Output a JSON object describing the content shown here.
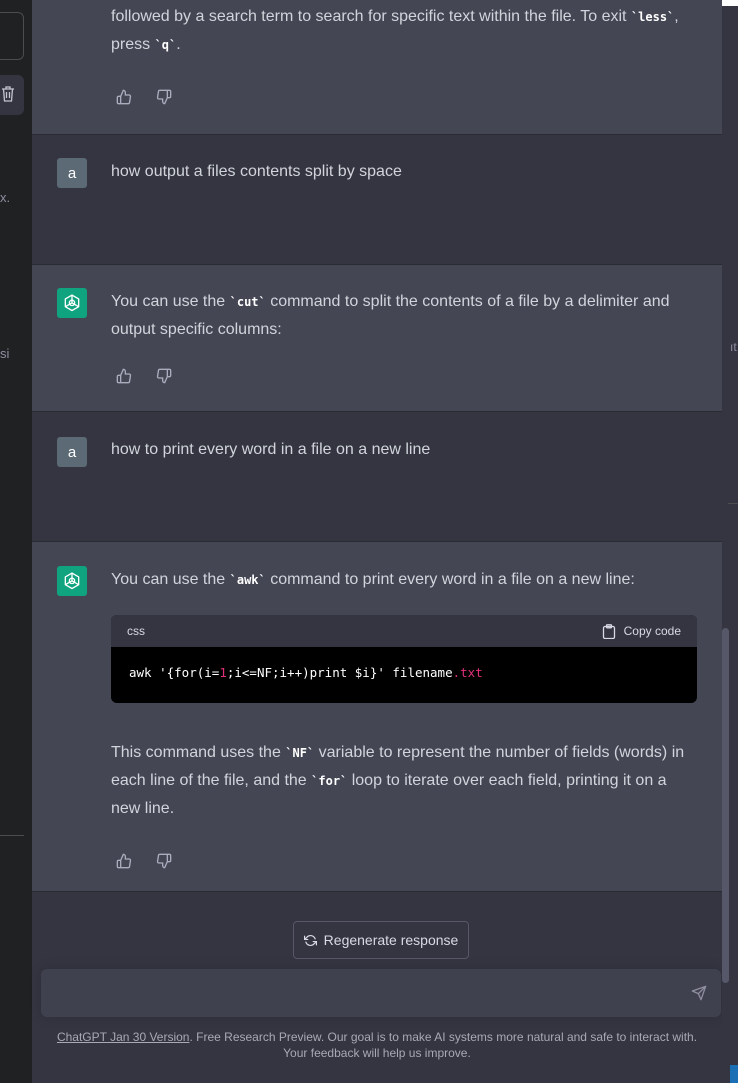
{
  "sidebar": {
    "frag_x": "x.",
    "frag_si": "si"
  },
  "messages": {
    "m0": {
      "role": "assistant",
      "text_a": "followed by a search term to search for specific text within the file. To exit ",
      "code_less": "`less`",
      "text_b": ", press ",
      "code_q": "`q`",
      "text_c": "."
    },
    "m1": {
      "role": "user",
      "avatar": "a",
      "text": "how output a files contents split by space"
    },
    "m2": {
      "role": "assistant",
      "text_a": "You can use the ",
      "code_cut": "`cut`",
      "text_b": " command to split the contents of a file by a delimiter and output specific columns:"
    },
    "m3": {
      "role": "user",
      "avatar": "a",
      "text": "how to print every word in a file on a new line"
    },
    "m4": {
      "role": "assistant",
      "text_a": "You can use the ",
      "code_awk": "`awk`",
      "text_b": " command to print every word in a file on a new line:",
      "code_lang": "css",
      "copy_label": "Copy code",
      "code_parts": {
        "p1": "awk '{for(i=",
        "p2": "1",
        "p3": ";i<=NF;i++)print $i}' filename",
        "p4": ".txt"
      },
      "explain_a": "This command uses the ",
      "code_nf": "`NF`",
      "explain_b": " variable to represent the number of fields (words) in each line of the file, and the ",
      "code_for": "`for`",
      "explain_c": " loop to iterate over each field, printing it on a new line."
    }
  },
  "regenerate_label": "Regenerate response",
  "input": {
    "placeholder": ""
  },
  "footer": {
    "link": "ChatGPT Jan 30 Version",
    "text": ". Free Research Preview. Our goal is to make AI systems more natural and safe to interact with. Your feedback will help us improve."
  },
  "right_frag": "ıt",
  "icons": {
    "thumbs_up": "thumbs-up-icon",
    "thumbs_down": "thumbs-down-icon",
    "copy": "clipboard-icon",
    "regenerate": "refresh-icon",
    "send": "paper-plane-icon",
    "trash": "trash-icon",
    "openai": "openai-logo-icon"
  },
  "colors": {
    "assistant_bg": "#444654",
    "user_bg": "#343541",
    "openai_green": "#10a37f",
    "code_accent": "#df3079"
  }
}
